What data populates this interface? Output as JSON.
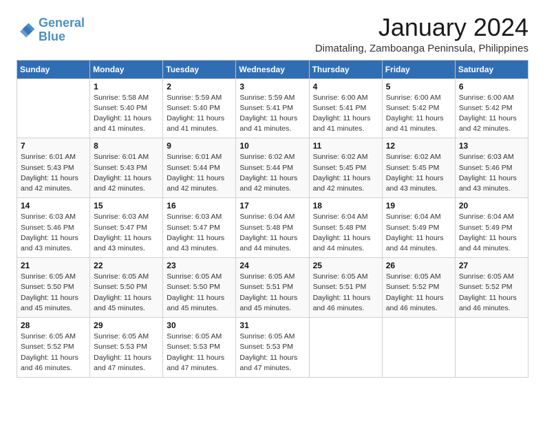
{
  "logo": {
    "line1": "General",
    "line2": "Blue"
  },
  "title": "January 2024",
  "subtitle": "Dimataling, Zamboanga Peninsula, Philippines",
  "weekdays": [
    "Sunday",
    "Monday",
    "Tuesday",
    "Wednesday",
    "Thursday",
    "Friday",
    "Saturday"
  ],
  "weeks": [
    [
      {
        "day": "",
        "sunrise": "",
        "sunset": "",
        "daylight": ""
      },
      {
        "day": "1",
        "sunrise": "Sunrise: 5:58 AM",
        "sunset": "Sunset: 5:40 PM",
        "daylight": "Daylight: 11 hours and 41 minutes."
      },
      {
        "day": "2",
        "sunrise": "Sunrise: 5:59 AM",
        "sunset": "Sunset: 5:40 PM",
        "daylight": "Daylight: 11 hours and 41 minutes."
      },
      {
        "day": "3",
        "sunrise": "Sunrise: 5:59 AM",
        "sunset": "Sunset: 5:41 PM",
        "daylight": "Daylight: 11 hours and 41 minutes."
      },
      {
        "day": "4",
        "sunrise": "Sunrise: 6:00 AM",
        "sunset": "Sunset: 5:41 PM",
        "daylight": "Daylight: 11 hours and 41 minutes."
      },
      {
        "day": "5",
        "sunrise": "Sunrise: 6:00 AM",
        "sunset": "Sunset: 5:42 PM",
        "daylight": "Daylight: 11 hours and 41 minutes."
      },
      {
        "day": "6",
        "sunrise": "Sunrise: 6:00 AM",
        "sunset": "Sunset: 5:42 PM",
        "daylight": "Daylight: 11 hours and 42 minutes."
      }
    ],
    [
      {
        "day": "7",
        "sunrise": "Sunrise: 6:01 AM",
        "sunset": "Sunset: 5:43 PM",
        "daylight": "Daylight: 11 hours and 42 minutes."
      },
      {
        "day": "8",
        "sunrise": "Sunrise: 6:01 AM",
        "sunset": "Sunset: 5:43 PM",
        "daylight": "Daylight: 11 hours and 42 minutes."
      },
      {
        "day": "9",
        "sunrise": "Sunrise: 6:01 AM",
        "sunset": "Sunset: 5:44 PM",
        "daylight": "Daylight: 11 hours and 42 minutes."
      },
      {
        "day": "10",
        "sunrise": "Sunrise: 6:02 AM",
        "sunset": "Sunset: 5:44 PM",
        "daylight": "Daylight: 11 hours and 42 minutes."
      },
      {
        "day": "11",
        "sunrise": "Sunrise: 6:02 AM",
        "sunset": "Sunset: 5:45 PM",
        "daylight": "Daylight: 11 hours and 42 minutes."
      },
      {
        "day": "12",
        "sunrise": "Sunrise: 6:02 AM",
        "sunset": "Sunset: 5:45 PM",
        "daylight": "Daylight: 11 hours and 43 minutes."
      },
      {
        "day": "13",
        "sunrise": "Sunrise: 6:03 AM",
        "sunset": "Sunset: 5:46 PM",
        "daylight": "Daylight: 11 hours and 43 minutes."
      }
    ],
    [
      {
        "day": "14",
        "sunrise": "Sunrise: 6:03 AM",
        "sunset": "Sunset: 5:46 PM",
        "daylight": "Daylight: 11 hours and 43 minutes."
      },
      {
        "day": "15",
        "sunrise": "Sunrise: 6:03 AM",
        "sunset": "Sunset: 5:47 PM",
        "daylight": "Daylight: 11 hours and 43 minutes."
      },
      {
        "day": "16",
        "sunrise": "Sunrise: 6:03 AM",
        "sunset": "Sunset: 5:47 PM",
        "daylight": "Daylight: 11 hours and 43 minutes."
      },
      {
        "day": "17",
        "sunrise": "Sunrise: 6:04 AM",
        "sunset": "Sunset: 5:48 PM",
        "daylight": "Daylight: 11 hours and 44 minutes."
      },
      {
        "day": "18",
        "sunrise": "Sunrise: 6:04 AM",
        "sunset": "Sunset: 5:48 PM",
        "daylight": "Daylight: 11 hours and 44 minutes."
      },
      {
        "day": "19",
        "sunrise": "Sunrise: 6:04 AM",
        "sunset": "Sunset: 5:49 PM",
        "daylight": "Daylight: 11 hours and 44 minutes."
      },
      {
        "day": "20",
        "sunrise": "Sunrise: 6:04 AM",
        "sunset": "Sunset: 5:49 PM",
        "daylight": "Daylight: 11 hours and 44 minutes."
      }
    ],
    [
      {
        "day": "21",
        "sunrise": "Sunrise: 6:05 AM",
        "sunset": "Sunset: 5:50 PM",
        "daylight": "Daylight: 11 hours and 45 minutes."
      },
      {
        "day": "22",
        "sunrise": "Sunrise: 6:05 AM",
        "sunset": "Sunset: 5:50 PM",
        "daylight": "Daylight: 11 hours and 45 minutes."
      },
      {
        "day": "23",
        "sunrise": "Sunrise: 6:05 AM",
        "sunset": "Sunset: 5:50 PM",
        "daylight": "Daylight: 11 hours and 45 minutes."
      },
      {
        "day": "24",
        "sunrise": "Sunrise: 6:05 AM",
        "sunset": "Sunset: 5:51 PM",
        "daylight": "Daylight: 11 hours and 45 minutes."
      },
      {
        "day": "25",
        "sunrise": "Sunrise: 6:05 AM",
        "sunset": "Sunset: 5:51 PM",
        "daylight": "Daylight: 11 hours and 46 minutes."
      },
      {
        "day": "26",
        "sunrise": "Sunrise: 6:05 AM",
        "sunset": "Sunset: 5:52 PM",
        "daylight": "Daylight: 11 hours and 46 minutes."
      },
      {
        "day": "27",
        "sunrise": "Sunrise: 6:05 AM",
        "sunset": "Sunset: 5:52 PM",
        "daylight": "Daylight: 11 hours and 46 minutes."
      }
    ],
    [
      {
        "day": "28",
        "sunrise": "Sunrise: 6:05 AM",
        "sunset": "Sunset: 5:52 PM",
        "daylight": "Daylight: 11 hours and 46 minutes."
      },
      {
        "day": "29",
        "sunrise": "Sunrise: 6:05 AM",
        "sunset": "Sunset: 5:53 PM",
        "daylight": "Daylight: 11 hours and 47 minutes."
      },
      {
        "day": "30",
        "sunrise": "Sunrise: 6:05 AM",
        "sunset": "Sunset: 5:53 PM",
        "daylight": "Daylight: 11 hours and 47 minutes."
      },
      {
        "day": "31",
        "sunrise": "Sunrise: 6:05 AM",
        "sunset": "Sunset: 5:53 PM",
        "daylight": "Daylight: 11 hours and 47 minutes."
      },
      {
        "day": "",
        "sunrise": "",
        "sunset": "",
        "daylight": ""
      },
      {
        "day": "",
        "sunrise": "",
        "sunset": "",
        "daylight": ""
      },
      {
        "day": "",
        "sunrise": "",
        "sunset": "",
        "daylight": ""
      }
    ]
  ]
}
